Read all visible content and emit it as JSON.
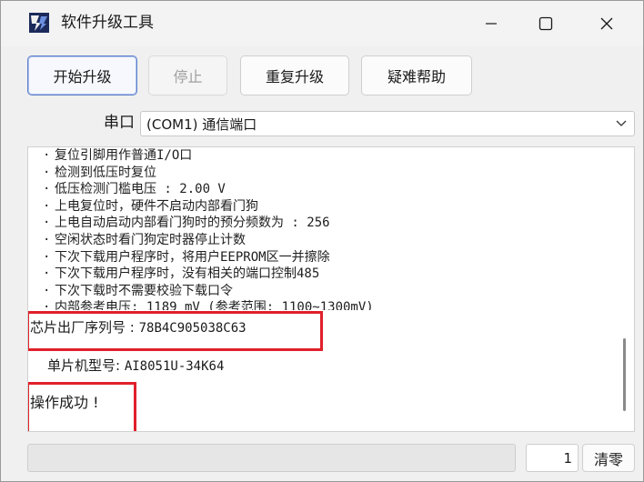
{
  "window": {
    "title": "软件升级工具",
    "icons": {
      "app": "app-logo-icon",
      "minimize": "minimize-icon",
      "maximize": "maximize-icon",
      "close": "close-icon"
    }
  },
  "toolbar": {
    "start_label": "开始升级",
    "stop_label": "停止",
    "repeat_label": "重复升级",
    "help_label": "疑难帮助"
  },
  "port": {
    "label": "串口",
    "selected": "(COM1) 通信端口",
    "arrow_icon": "chevron-down-icon"
  },
  "log": {
    "lines": [
      "复位引脚用作普通I/O口",
      "检测到低压时复位",
      "低压检测门槛电压 : 2.00 V",
      "上电复位时，硬件不启动内部看门狗",
      "上电自动启动内部看门狗时的预分频数为 : 256",
      "空闲状态时看门狗定时器停止计数",
      "下次下载用户程序时，将用户EEPROM区一并擦除",
      "下次下载用户程序时，没有相关的端口控制485",
      "下次下载时不需要校验下载口令",
      "内部参考电压: 1189 mV (参考范围: 1100~1300mV)"
    ],
    "serial_label": "芯片出厂序列号 : ",
    "serial_value": "78B4C905038C63",
    "model_label": "单片机型号: ",
    "model_value": "AI8051U-34K64",
    "result": "操作成功 !"
  },
  "status": {
    "message": "",
    "count": "1",
    "clear_label": "清零"
  },
  "colors": {
    "highlight": "#e0202a",
    "primary_border": "#5f7fc8",
    "window_bg": "#f0f0f0"
  }
}
